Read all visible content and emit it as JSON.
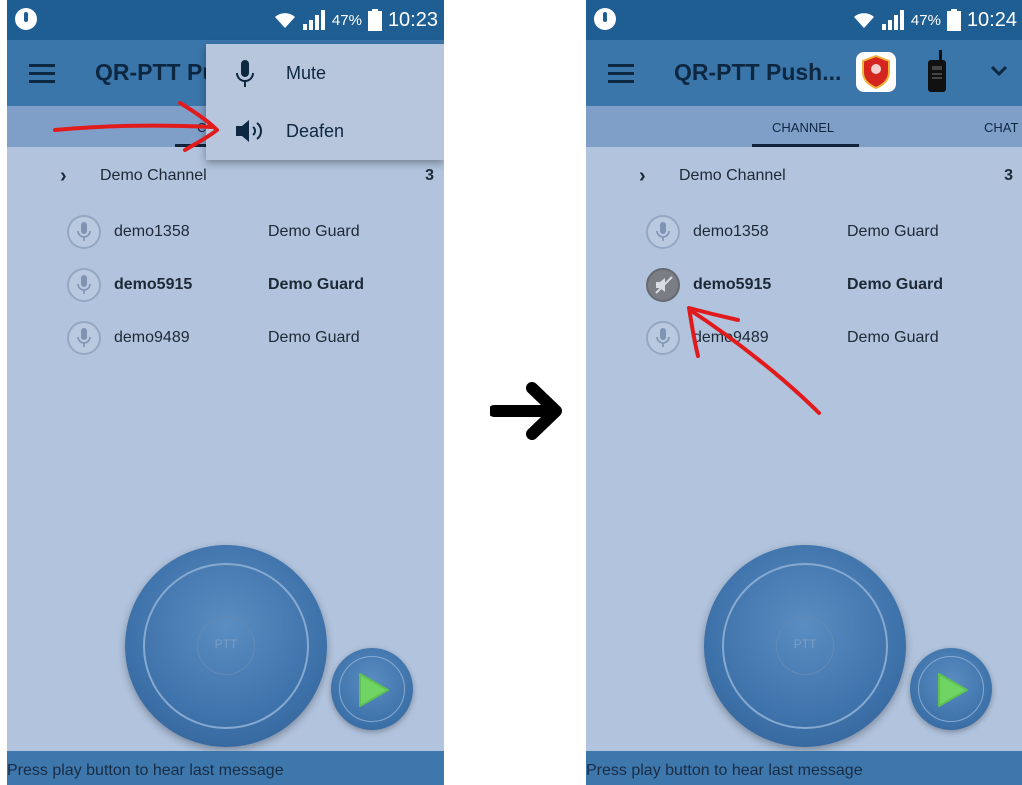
{
  "left_screen": {
    "status": {
      "battery": "47%",
      "time": "10:23"
    },
    "toolbar": {
      "title": "QR-PTT Pu"
    },
    "tabs": {
      "partial_label": "C"
    },
    "popup": {
      "items": [
        {
          "label": "Mute",
          "icon": "microphone-icon"
        },
        {
          "label": "Deafen",
          "icon": "speaker-icon"
        }
      ]
    },
    "channel": {
      "name": "Demo Channel",
      "count": "3"
    },
    "users": [
      {
        "name": "demo1358",
        "role": "Demo Guard"
      },
      {
        "name": "demo5915",
        "role": "Demo Guard"
      },
      {
        "name": "demo9489",
        "role": "Demo Guard"
      }
    ],
    "ptt": {
      "label": "PTT"
    },
    "footer": "Press play button to hear last message"
  },
  "right_screen": {
    "status": {
      "battery": "47%",
      "time": "10:24"
    },
    "toolbar": {
      "title": "QR-PTT Push..."
    },
    "tabs": {
      "channel": "CHANNEL",
      "chat": "CHAT"
    },
    "channel": {
      "name": "Demo Channel",
      "count": "3"
    },
    "users": [
      {
        "name": "demo1358",
        "role": "Demo Guard"
      },
      {
        "name": "demo5915",
        "role": "Demo Guard",
        "state": "deafened"
      },
      {
        "name": "demo9489",
        "role": "Demo Guard"
      }
    ],
    "ptt": {
      "label": "PTT"
    },
    "footer": "Press play button to hear last message"
  },
  "colors": {
    "statusbar": "#1f5e93",
    "toolbar": "#3b76ab",
    "tabs": "#7f9fc9",
    "background": "#b1c3dd",
    "annotation": "#e11b1b"
  }
}
